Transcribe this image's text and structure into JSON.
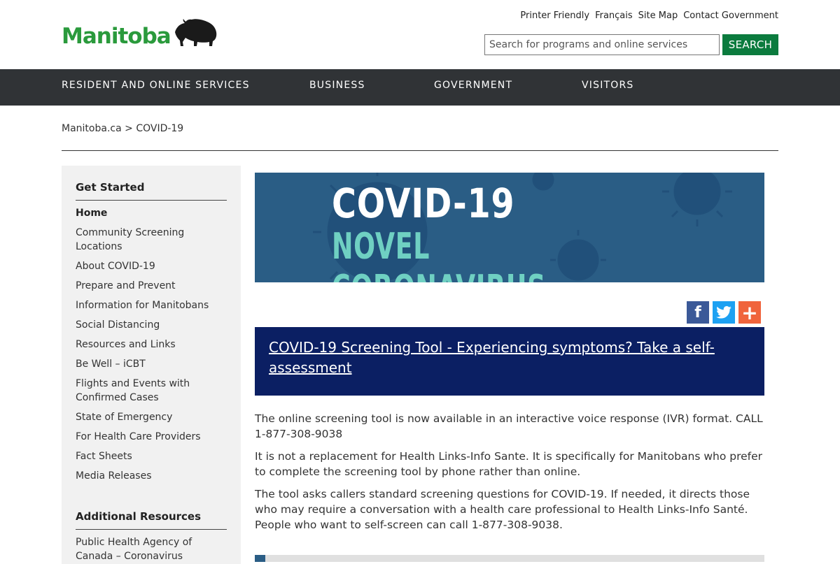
{
  "header": {
    "logo_text": "Manitoba",
    "util_links": [
      "Printer Friendly",
      "Français",
      "Site Map",
      "Contact Government"
    ],
    "search": {
      "placeholder": "Search for programs and online services",
      "value": "",
      "button": "SEARCH"
    }
  },
  "nav": {
    "items": [
      "RESIDENT AND ONLINE SERVICES",
      "BUSINESS",
      "GOVERNMENT",
      "VISITORS"
    ]
  },
  "breadcrumb": {
    "home": "Manitoba.ca",
    "separator": ">",
    "current": "COVID-19"
  },
  "sidebar": {
    "heading1": "Get Started",
    "items": [
      "Home",
      "Community Screening Locations",
      "About COVID-19",
      "Prepare and Prevent",
      "Information for Manitobans",
      "Social Distancing",
      "Resources and Links",
      "Be Well – iCBT",
      "Flights and Events with Confirmed Cases",
      "State of Emergency",
      "For Health Care Providers",
      "Fact Sheets",
      "Media Releases"
    ],
    "heading2": "Additional Resources",
    "resources": [
      "Public Health Agency of Canada – Coronavirus"
    ]
  },
  "main": {
    "banner": {
      "line1": "COVID-19",
      "line2": "NOVEL CORONAVIRUS"
    },
    "callout_link": "COVID-19 Screening Tool - Experiencing symptoms? Take a self-assessment",
    "paragraphs": [
      "The online screening tool is now available in an interactive voice response (IVR) format. CALL 1-877-308-9038",
      "It is not a replacement for Health Links-Info Sante. It is specifically for Manitobans who prefer to complete the screening tool by phone rather than online.",
      "The tool asks callers standard screening questions for COVID-19. If needed, it directs those who may require a conversation with a health care professional to Health Links-Info Santé. People who want to self-screen can call 1-877-308-9038."
    ]
  },
  "colors": {
    "brand_green": "#2a9a3c",
    "search_button": "#0b7b3e",
    "nav_bg": "#303336",
    "banner_bg": "#2a5d85",
    "callout_bg": "#0b1f63"
  },
  "icons": [
    "bison-logo-icon",
    "facebook-icon",
    "twitter-icon",
    "share-plus-icon"
  ]
}
